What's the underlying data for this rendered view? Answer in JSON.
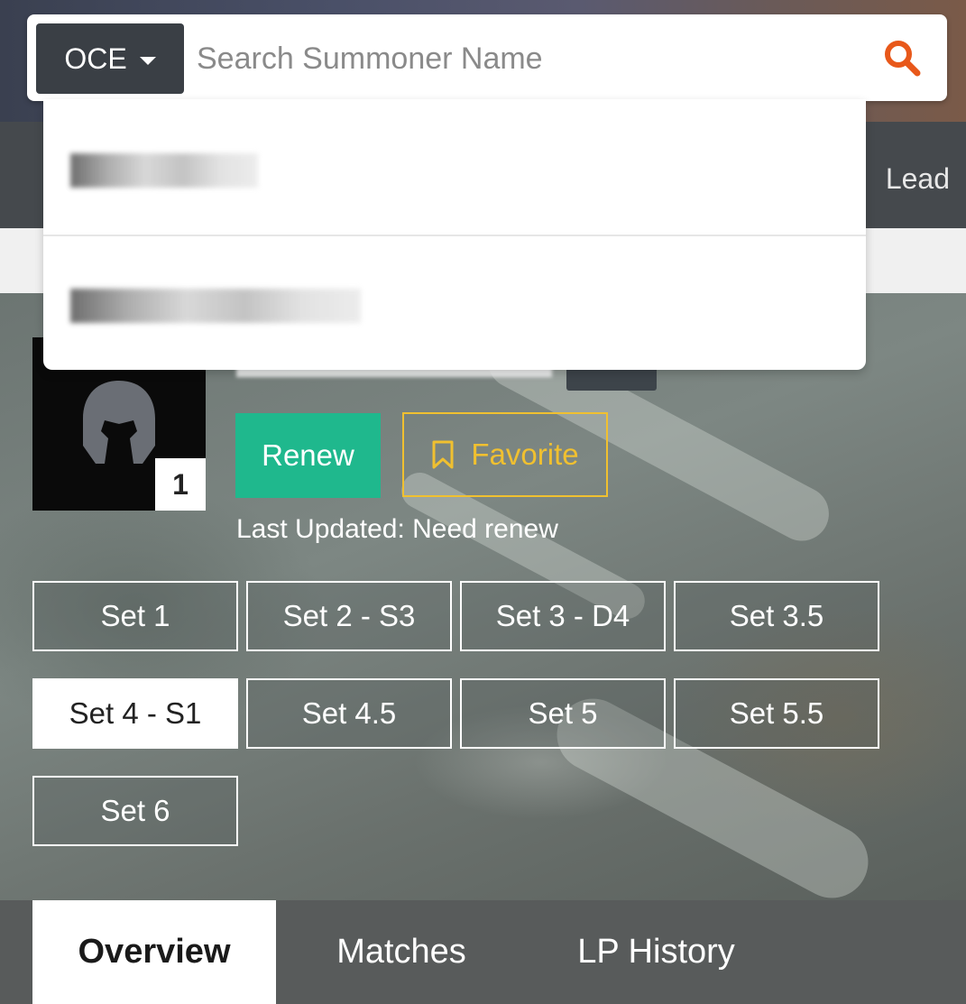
{
  "search": {
    "region": "OCE",
    "placeholder": "Search Summoner Name"
  },
  "nav": {
    "partial_item": "Lead"
  },
  "profile": {
    "level": "1",
    "renew_label": "Renew",
    "favorite_label": "Favorite",
    "last_updated": "Last Updated: Need renew"
  },
  "sets": [
    {
      "label": "Set 1",
      "active": false
    },
    {
      "label": "Set 2 - S3",
      "active": false
    },
    {
      "label": "Set 3 - D4",
      "active": false
    },
    {
      "label": "Set 3.5",
      "active": false
    },
    {
      "label": "Set 4 - S1",
      "active": true
    },
    {
      "label": "Set 4.5",
      "active": false
    },
    {
      "label": "Set 5",
      "active": false
    },
    {
      "label": "Set 5.5",
      "active": false
    },
    {
      "label": "Set 6",
      "active": false
    }
  ],
  "tabs": [
    {
      "label": "Overview",
      "active": true
    },
    {
      "label": "Matches",
      "active": false
    },
    {
      "label": "LP History",
      "active": false
    }
  ],
  "colors": {
    "renew": "#1fb88d",
    "favorite": "#f0c030",
    "search_icon": "#e8581a"
  }
}
